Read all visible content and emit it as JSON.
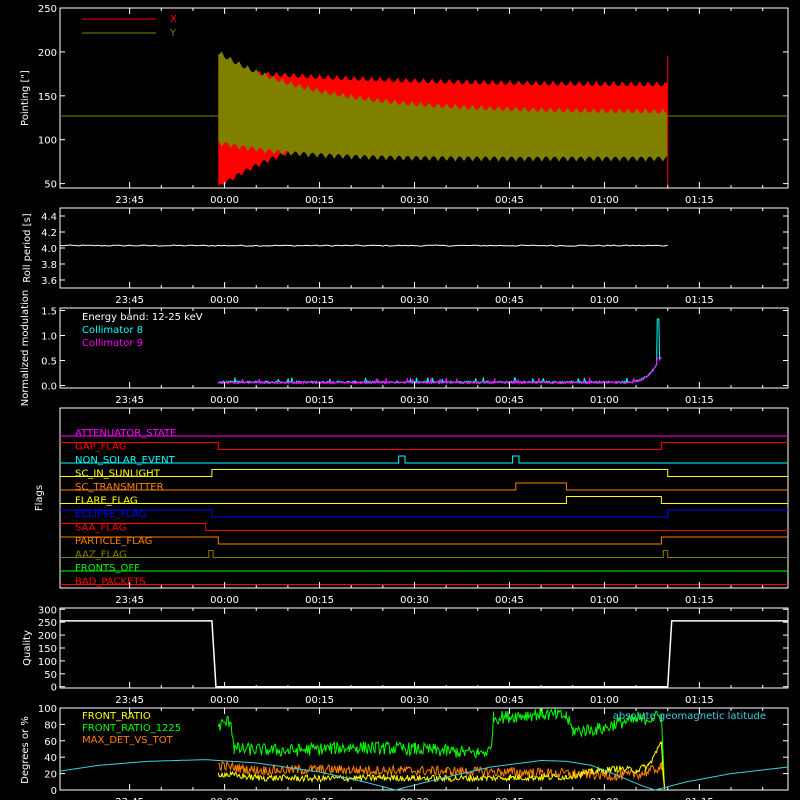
{
  "time_axis": {
    "ticks": [
      "23:45",
      "00:00",
      "00:15",
      "00:30",
      "00:45",
      "01:00",
      "01:15"
    ],
    "tick_minutes": [
      -15,
      0,
      15,
      30,
      45,
      60,
      75
    ],
    "range_minutes": [
      -26,
      89
    ]
  },
  "colors": {
    "x": "#ff0000",
    "y": "#808000",
    "white": "#ffffff",
    "cyan": "#00ffff",
    "magenta": "#ff00ff",
    "front_ratio": "#ffff00",
    "front_ratio_1225": "#00ff00",
    "max_det": "#ff8000",
    "geomag": "#40d0e0"
  },
  "chart_data": [
    {
      "id": "pointing",
      "type": "area",
      "ylabel": "Pointing [\"]",
      "ylim": [
        45,
        250
      ],
      "yticks": [
        50,
        100,
        150,
        200,
        250
      ],
      "legend": [
        "X",
        "Y"
      ],
      "baseline": 127,
      "data_start_minute": -1,
      "data_end_minute": 70,
      "series": [
        {
          "name": "X",
          "center_start": 112,
          "center_end": 144,
          "half_width_start": 70,
          "half_width_end": 22
        },
        {
          "name": "Y",
          "center_start": 148,
          "center_end": 105,
          "half_width_start": 55,
          "half_width_end": 30
        }
      ]
    },
    {
      "id": "roll",
      "type": "line",
      "ylabel": "Roll period [s]",
      "ylim": [
        3.5,
        4.5
      ],
      "yticks": [
        3.6,
        3.8,
        4.0,
        4.2,
        4.4
      ],
      "value": 4.03,
      "x_range_minutes": [
        -26,
        70
      ]
    },
    {
      "id": "modulation",
      "type": "line",
      "ylabel": "Normalized modulation",
      "ylim": [
        -0.05,
        1.55
      ],
      "yticks": [
        0.0,
        0.5,
        1.0,
        1.5
      ],
      "labels": [
        "Energy band: 12-25 keV",
        "Collimator 8",
        "Collimator 9"
      ],
      "series": [
        {
          "name": "Collimator 8",
          "base": 0.06,
          "noise": 0.04,
          "spike_minute": 68.5,
          "spike_value": 1.33
        },
        {
          "name": "Collimator 9",
          "base": 0.05,
          "noise": 0.04,
          "spike_minute": 68.5,
          "spike_value": 0.55
        }
      ],
      "x_range_minutes": [
        -1,
        69
      ]
    },
    {
      "id": "flags",
      "type": "line",
      "ylabel": "Flags",
      "rows": [
        {
          "label": "ATTENUATOR_STATE",
          "color": "#ff00ff",
          "segments": [
            [
              -26,
              89,
              0
            ]
          ]
        },
        {
          "label": "GAP_FLAG",
          "color": "#ff0000",
          "segments": [
            [
              -26,
              -1,
              1
            ],
            [
              -1,
              69,
              0
            ],
            [
              69,
              89,
              1
            ]
          ]
        },
        {
          "label": "NON_SOLAR_EVENT",
          "color": "#00ffff",
          "segments": [
            [
              -26,
              27.5,
              0
            ],
            [
              27.5,
              28.5,
              1
            ],
            [
              28.5,
              45.5,
              0
            ],
            [
              45.5,
              46.5,
              1
            ],
            [
              46.5,
              89,
              0
            ]
          ]
        },
        {
          "label": "SC_IN_SUNLIGHT",
          "color": "#ffff00",
          "segments": [
            [
              -26,
              -2,
              0
            ],
            [
              -2,
              70,
              1
            ],
            [
              70,
              89,
              0
            ]
          ]
        },
        {
          "label": "SC_TRANSMITTER",
          "color": "#ff8000",
          "segments": [
            [
              -26,
              46,
              0
            ],
            [
              46,
              54,
              1
            ],
            [
              54,
              89,
              0
            ]
          ]
        },
        {
          "label": "FLARE_FLAG",
          "color": "#ffff00",
          "segments": [
            [
              -26,
              54,
              0
            ],
            [
              54,
              69,
              1
            ],
            [
              69,
              89,
              0
            ]
          ]
        },
        {
          "label": "ECLIPSE_FLAG",
          "color": "#0000ff",
          "segments": [
            [
              -26,
              -2,
              1
            ],
            [
              -2,
              70,
              0
            ],
            [
              70,
              89,
              1
            ]
          ]
        },
        {
          "label": "SAA_FLAG",
          "color": "#ff0000",
          "segments": [
            [
              -26,
              -3,
              1
            ],
            [
              -3,
              89,
              0
            ]
          ]
        },
        {
          "label": "PARTICLE_FLAG",
          "color": "#ff8000",
          "segments": [
            [
              -26,
              -1,
              1
            ],
            [
              -1,
              69,
              0
            ],
            [
              69,
              89,
              1
            ]
          ]
        },
        {
          "label": "AAZ_FLAG",
          "color": "#808000",
          "segments": [
            [
              -26,
              -2.5,
              0
            ],
            [
              -2.5,
              -1.8,
              1
            ],
            [
              -1.8,
              69.3,
              0
            ],
            [
              69.3,
              70,
              1
            ],
            [
              70,
              89,
              0
            ]
          ]
        },
        {
          "label": "FRONTS_OFF",
          "color": "#00ff00",
          "segments": [
            [
              -26,
              89,
              0
            ]
          ]
        },
        {
          "label": "BAD_PACKETS",
          "color": "#ff0000",
          "segments": [
            [
              -26,
              89,
              0
            ]
          ]
        }
      ]
    },
    {
      "id": "quality",
      "type": "line",
      "ylabel": "Quality",
      "ylim": [
        -5,
        305
      ],
      "yticks": [
        0,
        50,
        100,
        150,
        200,
        250,
        300
      ],
      "high": 255,
      "low": 0,
      "drop_minute": -2,
      "rise_minute": 70
    },
    {
      "id": "ratios",
      "type": "line",
      "ylabel": "Degrees or %",
      "ylim": [
        0,
        100
      ],
      "yticks": [
        0,
        20,
        40,
        60,
        80,
        100
      ],
      "legend": [
        "FRONT_RATIO",
        "FRONT_RATIO_1225",
        "MAX_DET_VS_TOT"
      ],
      "annotation": "absolute geomagnetic latitude",
      "series": [
        {
          "name": "FRONT_RATIO_1225",
          "points": [
            [
              -1,
              78
            ],
            [
              1,
              85
            ],
            [
              1.5,
              50
            ],
            [
              10,
              48
            ],
            [
              20,
              52
            ],
            [
              30,
              50
            ],
            [
              40,
              45
            ],
            [
              42,
              48
            ],
            [
              42.5,
              88
            ],
            [
              50,
              93
            ],
            [
              54,
              90
            ],
            [
              55,
              72
            ],
            [
              60,
              75
            ],
            [
              62,
              82
            ],
            [
              65,
              85
            ],
            [
              69,
              90
            ],
            [
              69.5,
              0
            ]
          ]
        },
        {
          "name": "MAX_DET_VS_TOT",
          "points": [
            [
              -1,
              30
            ],
            [
              5,
              24
            ],
            [
              15,
              25
            ],
            [
              25,
              24
            ],
            [
              35,
              23
            ],
            [
              45,
              22
            ],
            [
              55,
              20
            ],
            [
              62,
              17
            ],
            [
              66,
              20
            ],
            [
              69,
              28
            ],
            [
              69.5,
              0
            ]
          ]
        },
        {
          "name": "FRONT_RATIO",
          "points": [
            [
              -1,
              20
            ],
            [
              5,
              15
            ],
            [
              15,
              14
            ],
            [
              25,
              15
            ],
            [
              35,
              14
            ],
            [
              45,
              15
            ],
            [
              54,
              16
            ],
            [
              58,
              22
            ],
            [
              62,
              26
            ],
            [
              65,
              24
            ],
            [
              67,
              30
            ],
            [
              69,
              58
            ],
            [
              69.5,
              0
            ]
          ]
        },
        {
          "name": "absolute geomagnetic latitude",
          "points": [
            [
              -26,
              23
            ],
            [
              -20,
              30
            ],
            [
              -12,
              35
            ],
            [
              -3,
              37
            ],
            [
              5,
              33
            ],
            [
              15,
              22
            ],
            [
              22,
              10
            ],
            [
              27,
              0
            ],
            [
              33,
              12
            ],
            [
              42,
              28
            ],
            [
              50,
              36
            ],
            [
              54,
              35
            ],
            [
              58,
              30
            ],
            [
              62,
              18
            ],
            [
              66,
              5
            ],
            [
              68,
              0
            ],
            [
              73,
              10
            ],
            [
              80,
              20
            ],
            [
              89,
              28
            ]
          ]
        }
      ]
    }
  ]
}
